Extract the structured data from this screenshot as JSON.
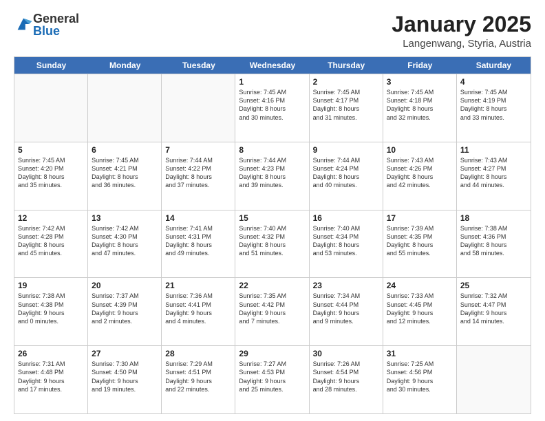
{
  "logo": {
    "general": "General",
    "blue": "Blue"
  },
  "header": {
    "month": "January 2025",
    "location": "Langenwang, Styria, Austria"
  },
  "weekdays": [
    "Sunday",
    "Monday",
    "Tuesday",
    "Wednesday",
    "Thursday",
    "Friday",
    "Saturday"
  ],
  "weeks": [
    [
      {
        "day": "",
        "info": ""
      },
      {
        "day": "",
        "info": ""
      },
      {
        "day": "",
        "info": ""
      },
      {
        "day": "1",
        "info": "Sunrise: 7:45 AM\nSunset: 4:16 PM\nDaylight: 8 hours\nand 30 minutes."
      },
      {
        "day": "2",
        "info": "Sunrise: 7:45 AM\nSunset: 4:17 PM\nDaylight: 8 hours\nand 31 minutes."
      },
      {
        "day": "3",
        "info": "Sunrise: 7:45 AM\nSunset: 4:18 PM\nDaylight: 8 hours\nand 32 minutes."
      },
      {
        "day": "4",
        "info": "Sunrise: 7:45 AM\nSunset: 4:19 PM\nDaylight: 8 hours\nand 33 minutes."
      }
    ],
    [
      {
        "day": "5",
        "info": "Sunrise: 7:45 AM\nSunset: 4:20 PM\nDaylight: 8 hours\nand 35 minutes."
      },
      {
        "day": "6",
        "info": "Sunrise: 7:45 AM\nSunset: 4:21 PM\nDaylight: 8 hours\nand 36 minutes."
      },
      {
        "day": "7",
        "info": "Sunrise: 7:44 AM\nSunset: 4:22 PM\nDaylight: 8 hours\nand 37 minutes."
      },
      {
        "day": "8",
        "info": "Sunrise: 7:44 AM\nSunset: 4:23 PM\nDaylight: 8 hours\nand 39 minutes."
      },
      {
        "day": "9",
        "info": "Sunrise: 7:44 AM\nSunset: 4:24 PM\nDaylight: 8 hours\nand 40 minutes."
      },
      {
        "day": "10",
        "info": "Sunrise: 7:43 AM\nSunset: 4:26 PM\nDaylight: 8 hours\nand 42 minutes."
      },
      {
        "day": "11",
        "info": "Sunrise: 7:43 AM\nSunset: 4:27 PM\nDaylight: 8 hours\nand 44 minutes."
      }
    ],
    [
      {
        "day": "12",
        "info": "Sunrise: 7:42 AM\nSunset: 4:28 PM\nDaylight: 8 hours\nand 45 minutes."
      },
      {
        "day": "13",
        "info": "Sunrise: 7:42 AM\nSunset: 4:30 PM\nDaylight: 8 hours\nand 47 minutes."
      },
      {
        "day": "14",
        "info": "Sunrise: 7:41 AM\nSunset: 4:31 PM\nDaylight: 8 hours\nand 49 minutes."
      },
      {
        "day": "15",
        "info": "Sunrise: 7:40 AM\nSunset: 4:32 PM\nDaylight: 8 hours\nand 51 minutes."
      },
      {
        "day": "16",
        "info": "Sunrise: 7:40 AM\nSunset: 4:34 PM\nDaylight: 8 hours\nand 53 minutes."
      },
      {
        "day": "17",
        "info": "Sunrise: 7:39 AM\nSunset: 4:35 PM\nDaylight: 8 hours\nand 55 minutes."
      },
      {
        "day": "18",
        "info": "Sunrise: 7:38 AM\nSunset: 4:36 PM\nDaylight: 8 hours\nand 58 minutes."
      }
    ],
    [
      {
        "day": "19",
        "info": "Sunrise: 7:38 AM\nSunset: 4:38 PM\nDaylight: 9 hours\nand 0 minutes."
      },
      {
        "day": "20",
        "info": "Sunrise: 7:37 AM\nSunset: 4:39 PM\nDaylight: 9 hours\nand 2 minutes."
      },
      {
        "day": "21",
        "info": "Sunrise: 7:36 AM\nSunset: 4:41 PM\nDaylight: 9 hours\nand 4 minutes."
      },
      {
        "day": "22",
        "info": "Sunrise: 7:35 AM\nSunset: 4:42 PM\nDaylight: 9 hours\nand 7 minutes."
      },
      {
        "day": "23",
        "info": "Sunrise: 7:34 AM\nSunset: 4:44 PM\nDaylight: 9 hours\nand 9 minutes."
      },
      {
        "day": "24",
        "info": "Sunrise: 7:33 AM\nSunset: 4:45 PM\nDaylight: 9 hours\nand 12 minutes."
      },
      {
        "day": "25",
        "info": "Sunrise: 7:32 AM\nSunset: 4:47 PM\nDaylight: 9 hours\nand 14 minutes."
      }
    ],
    [
      {
        "day": "26",
        "info": "Sunrise: 7:31 AM\nSunset: 4:48 PM\nDaylight: 9 hours\nand 17 minutes."
      },
      {
        "day": "27",
        "info": "Sunrise: 7:30 AM\nSunset: 4:50 PM\nDaylight: 9 hours\nand 19 minutes."
      },
      {
        "day": "28",
        "info": "Sunrise: 7:29 AM\nSunset: 4:51 PM\nDaylight: 9 hours\nand 22 minutes."
      },
      {
        "day": "29",
        "info": "Sunrise: 7:27 AM\nSunset: 4:53 PM\nDaylight: 9 hours\nand 25 minutes."
      },
      {
        "day": "30",
        "info": "Sunrise: 7:26 AM\nSunset: 4:54 PM\nDaylight: 9 hours\nand 28 minutes."
      },
      {
        "day": "31",
        "info": "Sunrise: 7:25 AM\nSunset: 4:56 PM\nDaylight: 9 hours\nand 30 minutes."
      },
      {
        "day": "",
        "info": ""
      }
    ]
  ]
}
